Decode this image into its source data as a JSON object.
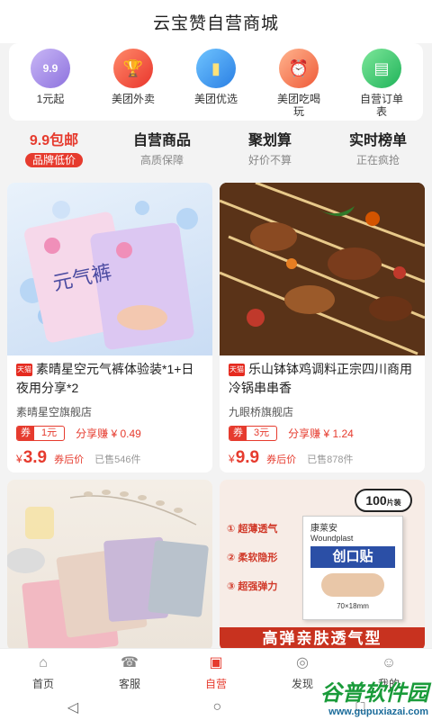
{
  "header": {
    "title": "云宝赞自营商城"
  },
  "categories": [
    {
      "label": "1元起",
      "icon": "price-9-9-icon",
      "glyph": "9.9"
    },
    {
      "label": "美团外卖",
      "icon": "trophy-icon",
      "glyph": "🏆"
    },
    {
      "label": "美团优选",
      "icon": "battery-icon",
      "glyph": "▮"
    },
    {
      "label": "美团吃喝玩",
      "icon": "alarm-clock-icon",
      "glyph": "⏰"
    },
    {
      "label": "自营订单表",
      "icon": "list-box-icon",
      "glyph": "▤"
    }
  ],
  "tabs": [
    {
      "main": "9.9包邮",
      "sub": "品牌低价",
      "active": true
    },
    {
      "main": "自营商品",
      "sub": "高质保障"
    },
    {
      "main": "聚划算",
      "sub": "好价不算"
    },
    {
      "main": "实时榜单",
      "sub": "正在疯抢"
    }
  ],
  "products": [
    {
      "tag": "天猫",
      "title": "素晴星空元气裤体验装*1+日夜用分享*2",
      "shop": "素晴星空旗舰店",
      "coupon_label": "券",
      "coupon_value": "1元",
      "share": "分享赚 ¥ 0.49",
      "currency": "¥",
      "price": "3.9",
      "price_note": "券后价",
      "sold": "已售546件",
      "image_text": "元气裤"
    },
    {
      "tag": "天猫",
      "title": "乐山钵钵鸡调料正宗四川商用冷锅串串香",
      "shop": "九眼桥旗舰店",
      "coupon_label": "券",
      "coupon_value": "3元",
      "share": "分享赚 ¥ 1.24",
      "currency": "¥",
      "price": "9.9",
      "price_note": "券后价",
      "sold": "已售878件"
    },
    {
      "image_desc": "towels"
    },
    {
      "image_lines": [
        "超薄透气",
        "柔软隐形",
        "超强弹力"
      ],
      "image_brand": "康莱安",
      "image_en": "Woundplast",
      "image_cn": "创口贴",
      "image_badge": "100",
      "image_badge_unit": "片装",
      "image_size": "70×18mm",
      "image_banner": "高弹亲肤透气型"
    }
  ],
  "tabbar": [
    {
      "label": "首页",
      "icon": "home-icon",
      "glyph": "⌂"
    },
    {
      "label": "客服",
      "icon": "customer-service-icon",
      "glyph": "☎"
    },
    {
      "label": "自营",
      "icon": "shop-icon",
      "glyph": "▣",
      "active": true
    },
    {
      "label": "发现",
      "icon": "compass-icon",
      "glyph": "◎"
    },
    {
      "label": "我的",
      "icon": "user-icon",
      "glyph": "☺"
    }
  ],
  "watermark": {
    "big": "谷普软件园",
    "small": "www.gupuxiazai.com"
  },
  "colors": {
    "accent": "#e63b2e",
    "background": "#f3f3f3"
  }
}
